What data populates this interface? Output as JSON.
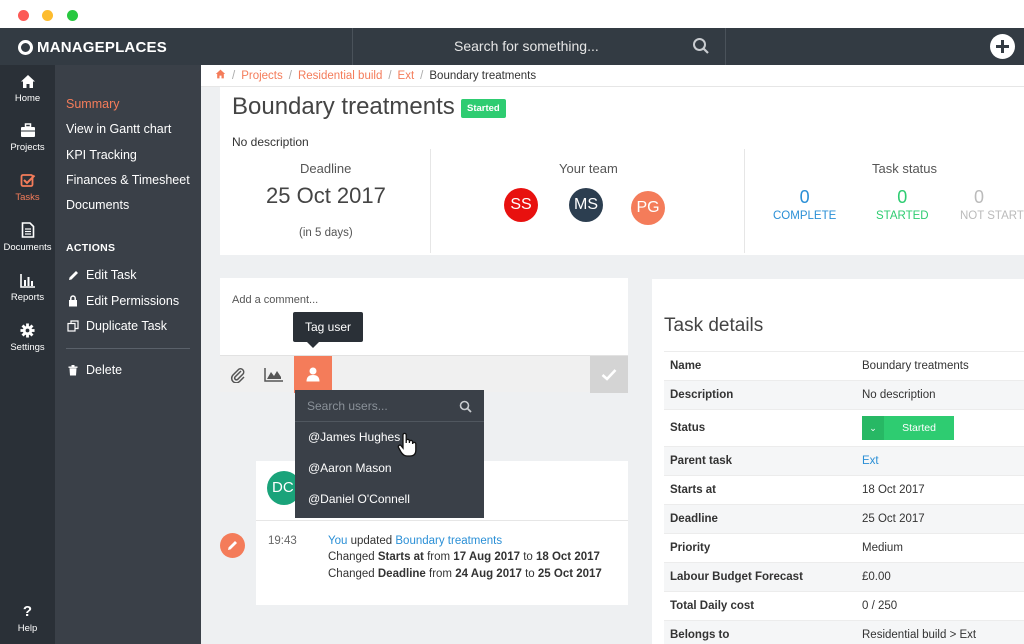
{
  "app": {
    "logo": "MANAGEPLACES"
  },
  "topbar": {
    "search_placeholder": "Search for something..."
  },
  "rail": [
    {
      "label": "Home",
      "icon": "home-icon"
    },
    {
      "label": "Projects",
      "icon": "briefcase-icon"
    },
    {
      "label": "Tasks",
      "icon": "checkbox-icon",
      "active": true
    },
    {
      "label": "Documents",
      "icon": "document-icon"
    },
    {
      "label": "Reports",
      "icon": "bar-chart-icon"
    },
    {
      "label": "Settings",
      "icon": "gear-icon"
    },
    {
      "label": "Help",
      "icon": "question-icon"
    }
  ],
  "submenu": {
    "items": [
      "Summary",
      "View in Gantt chart",
      "KPI Tracking",
      "Finances & Timesheet",
      "Documents"
    ],
    "actions_heading": "ACTIONS",
    "actions": [
      "Edit Task",
      "Edit Permissions",
      "Duplicate Task",
      "Delete"
    ]
  },
  "breadcrumb": {
    "items": [
      "Projects",
      "Residential build",
      "Ext"
    ],
    "current": "Boundary treatments"
  },
  "header": {
    "title": "Boundary treatments",
    "badge": "Started",
    "description": "No description",
    "deadline_label": "Deadline",
    "deadline_date": "25 Oct 2017",
    "deadline_sub": "(in 5 days)",
    "team_label": "Your team",
    "team": [
      {
        "initials": "SS",
        "color": "#e8110f"
      },
      {
        "initials": "MS",
        "color": "#2c3e50"
      },
      {
        "initials": "PG",
        "color": "#f47c5a"
      }
    ],
    "status_label": "Task status",
    "stats": [
      {
        "num": "0",
        "label": "COMPLETE",
        "color": "#2a8fd6"
      },
      {
        "num": "0",
        "label": "STARTED",
        "color": "#2ecc71"
      },
      {
        "num": "0",
        "label": "NOT STARTED",
        "color": "#bbbbbb"
      }
    ]
  },
  "comment": {
    "placeholder": "Add a comment...",
    "tooltip": "Tag user"
  },
  "tag_dropdown": {
    "search_placeholder": "Search users...",
    "users": [
      "@James Hughes",
      "@Aaron Mason",
      "@Daniel O'Connell"
    ]
  },
  "activity": {
    "avatar": "DC",
    "time": "19:43",
    "line1": {
      "actor": "You",
      "verb": " updated ",
      "target": "Boundary treatments"
    },
    "line2": {
      "a": "Changed ",
      "field": "Starts at",
      "b": " from ",
      "from": "17 Aug 2017",
      "c": " to ",
      "to": "18 Oct 2017"
    },
    "line3": {
      "a": "Changed ",
      "field": "Deadline",
      "b": " from ",
      "from": "24 Aug 2017",
      "c": " to ",
      "to": "25 Oct 2017"
    }
  },
  "details": {
    "title": "Task details",
    "rows": [
      {
        "label": "Name",
        "value": "Boundary treatments"
      },
      {
        "label": "Description",
        "value": "No description"
      },
      {
        "label": "Status",
        "value": "Started"
      },
      {
        "label": "Parent task",
        "value": "Ext"
      },
      {
        "label": "Starts at",
        "value": "18 Oct 2017"
      },
      {
        "label": "Deadline",
        "value": "25 Oct 2017"
      },
      {
        "label": "Priority",
        "value": "Medium"
      },
      {
        "label": "Labour Budget Forecast",
        "value": "£0.00"
      },
      {
        "label": "Total Daily cost",
        "value": "0 / 250"
      },
      {
        "label": "Belongs to",
        "value": "Residential build > Ext"
      }
    ]
  },
  "colors": {
    "accent": "#f47c5a",
    "dark": "#333b43",
    "rail": "#2a3037",
    "submenu": "#3a4048",
    "green": "#2ecc71",
    "blue": "#2a8fd6"
  }
}
